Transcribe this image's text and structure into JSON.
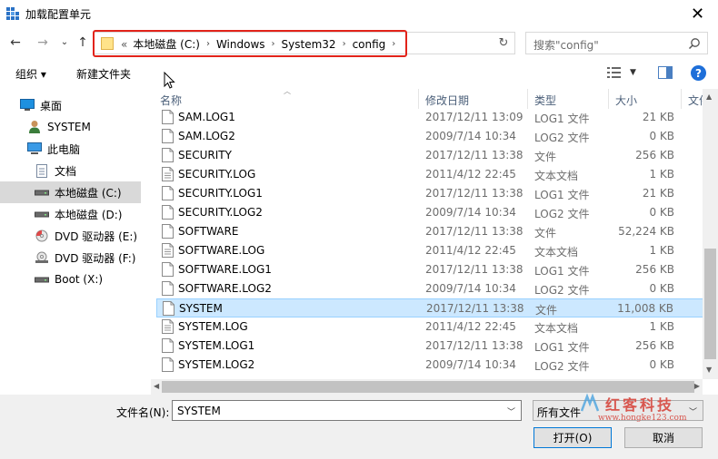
{
  "window": {
    "title": "加载配置单元",
    "close_glyph": "✕"
  },
  "nav": {
    "back_glyph": "←",
    "forward_glyph": "→",
    "recent_glyph": "⌄",
    "up_glyph": "↑",
    "breadcrumb_prefix": "«",
    "breadcrumbs": [
      "本地磁盘 (C:)",
      "Windows",
      "System32",
      "config"
    ],
    "refresh_glyph": "↻"
  },
  "search": {
    "placeholder": "搜索\"config\""
  },
  "toolbar": {
    "organize_label": "组织 ▾",
    "new_folder_label": "新建文件夹"
  },
  "sidebar": {
    "items": [
      {
        "label": "桌面",
        "icon": "desktop-icon",
        "selected": false
      },
      {
        "label": "SYSTEM",
        "icon": "user-icon",
        "selected": false
      },
      {
        "label": "此电脑",
        "icon": "computer-icon",
        "selected": false
      },
      {
        "label": "文档",
        "icon": "document-icon",
        "selected": false
      },
      {
        "label": "本地磁盘 (C:)",
        "icon": "drive-icon",
        "selected": true
      },
      {
        "label": "本地磁盘 (D:)",
        "icon": "drive-icon",
        "selected": false
      },
      {
        "label": "DVD 驱动器 (E:) E",
        "icon": "dvd-drive-icon",
        "selected": false
      },
      {
        "label": "DVD 驱动器 (F:)",
        "icon": "dvd-drive-icon",
        "selected": false
      },
      {
        "label": "Boot (X:)",
        "icon": "drive-icon",
        "selected": false
      }
    ]
  },
  "columns": {
    "name": "名称",
    "date": "修改日期",
    "type": "类型",
    "size": "大小",
    "extra": "文件"
  },
  "files": [
    {
      "name": "SAM.LOG1",
      "date": "2017/12/11 13:09",
      "type": "LOG1 文件",
      "size": "21 KB",
      "selected": false
    },
    {
      "name": "SAM.LOG2",
      "date": "2009/7/14 10:34",
      "type": "LOG2 文件",
      "size": "0 KB",
      "selected": false
    },
    {
      "name": "SECURITY",
      "date": "2017/12/11 13:38",
      "type": "文件",
      "size": "256 KB",
      "selected": false
    },
    {
      "name": "SECURITY.LOG",
      "date": "2011/4/12 22:45",
      "type": "文本文档",
      "size": "1 KB",
      "selected": false
    },
    {
      "name": "SECURITY.LOG1",
      "date": "2017/12/11 13:38",
      "type": "LOG1 文件",
      "size": "21 KB",
      "selected": false
    },
    {
      "name": "SECURITY.LOG2",
      "date": "2009/7/14 10:34",
      "type": "LOG2 文件",
      "size": "0 KB",
      "selected": false
    },
    {
      "name": "SOFTWARE",
      "date": "2017/12/11 13:38",
      "type": "文件",
      "size": "52,224 KB",
      "selected": false
    },
    {
      "name": "SOFTWARE.LOG",
      "date": "2011/4/12 22:45",
      "type": "文本文档",
      "size": "1 KB",
      "selected": false
    },
    {
      "name": "SOFTWARE.LOG1",
      "date": "2017/12/11 13:38",
      "type": "LOG1 文件",
      "size": "256 KB",
      "selected": false
    },
    {
      "name": "SOFTWARE.LOG2",
      "date": "2009/7/14 10:34",
      "type": "LOG2 文件",
      "size": "0 KB",
      "selected": false
    },
    {
      "name": "SYSTEM",
      "date": "2017/12/11 13:38",
      "type": "文件",
      "size": "11,008 KB",
      "selected": true
    },
    {
      "name": "SYSTEM.LOG",
      "date": "2011/4/12 22:45",
      "type": "文本文档",
      "size": "1 KB",
      "selected": false
    },
    {
      "name": "SYSTEM.LOG1",
      "date": "2017/12/11 13:38",
      "type": "LOG1 文件",
      "size": "256 KB",
      "selected": false
    },
    {
      "name": "SYSTEM.LOG2",
      "date": "2009/7/14 10:34",
      "type": "LOG2 文件",
      "size": "0 KB",
      "selected": false
    }
  ],
  "bottom": {
    "filename_label": "文件名(N):",
    "filename_value": "SYSTEM",
    "filetype_value": "所有文件",
    "open_label": "打开(O)",
    "cancel_label": "取消"
  },
  "watermark": {
    "main": "红客科技",
    "sub": "www.hongke123.com"
  },
  "colors": {
    "selection": "#cce8ff",
    "highlight_box": "#e2231a",
    "accent": "#0078d7",
    "watermark": "#d8574f"
  }
}
